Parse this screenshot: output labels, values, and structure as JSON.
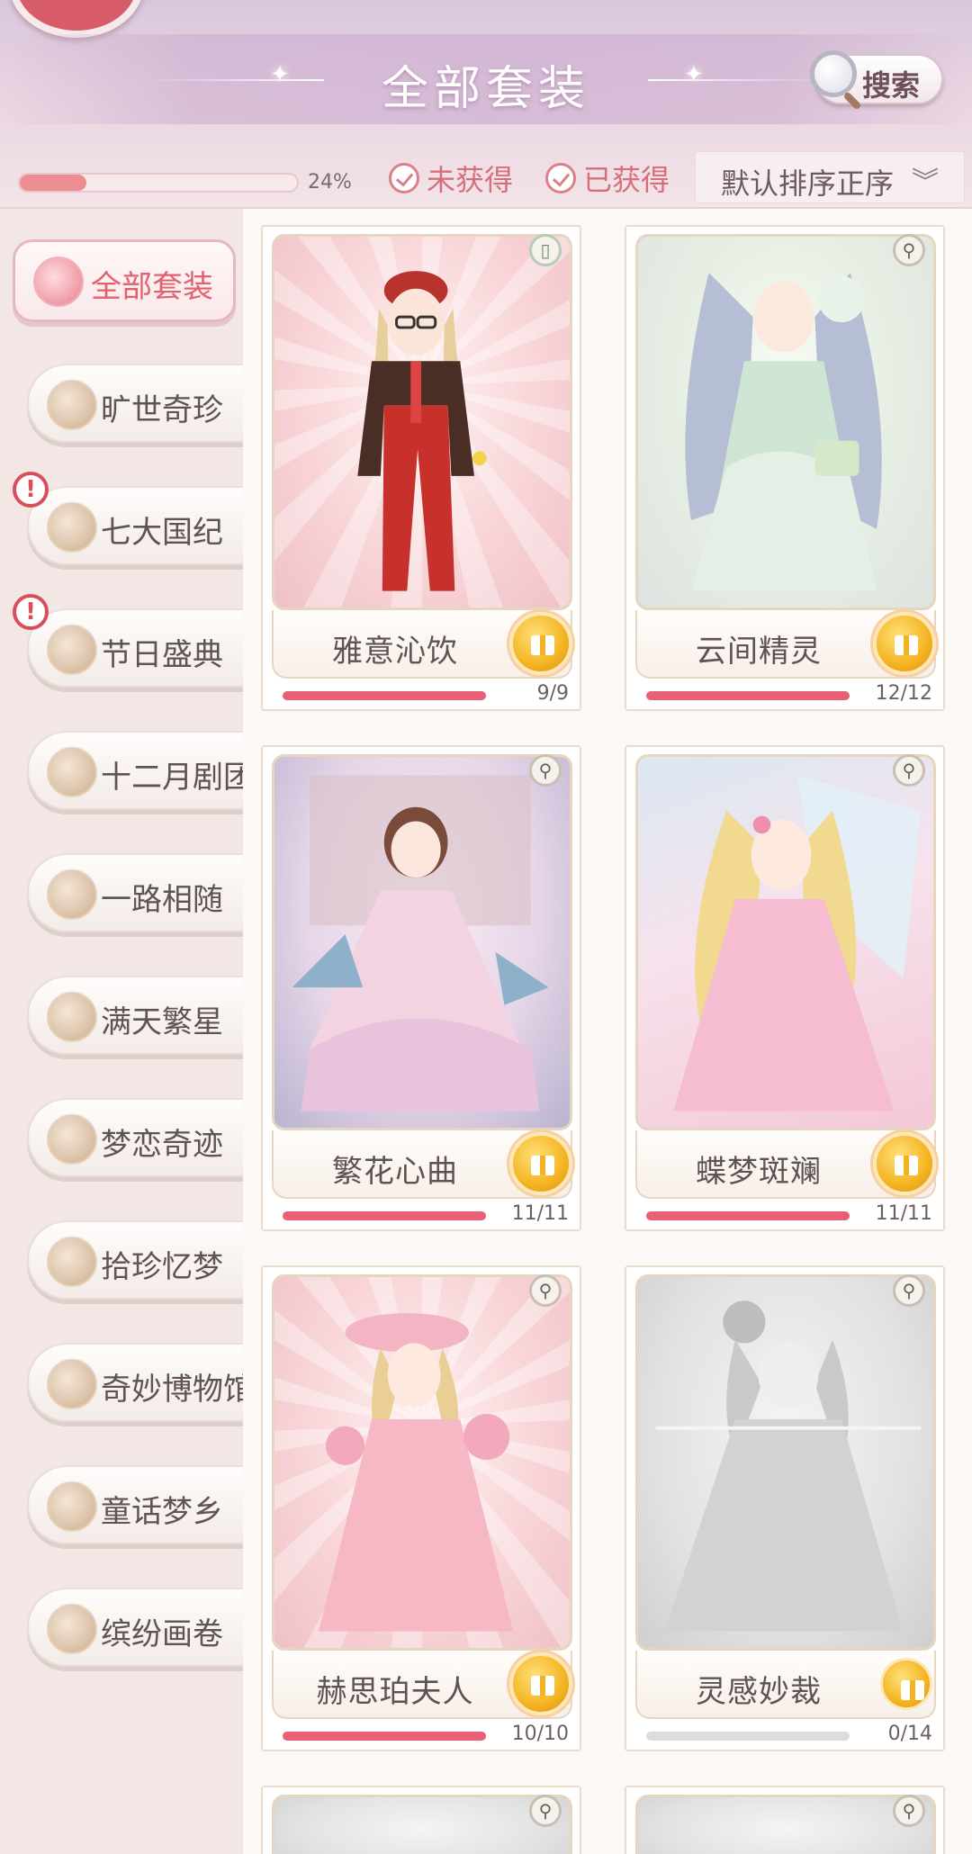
{
  "header": {
    "title": "全部套装",
    "search_label": "搜索",
    "progress_text": "24%",
    "progress_fraction": 0.24,
    "filters": [
      {
        "label": "未获得"
      },
      {
        "label": "已获得"
      }
    ],
    "sort_label": "默认排序正序",
    "sort_chevron": "︾"
  },
  "sidebar": {
    "items": [
      {
        "label": "全部套装",
        "active": true
      },
      {
        "label": "旷世奇珍"
      },
      {
        "label": "七大国纪",
        "alert": true
      },
      {
        "label": "节日盛典",
        "alert": true
      },
      {
        "label": "十二月剧团"
      },
      {
        "label": "一路相随"
      },
      {
        "label": "满天繁星"
      },
      {
        "label": "梦恋奇迹"
      },
      {
        "label": "拾珍忆梦"
      },
      {
        "label": "奇妙博物馆"
      },
      {
        "label": "童话梦乡"
      },
      {
        "label": "缤纷画卷"
      }
    ],
    "alert_glyph": "!"
  },
  "cards": [
    {
      "name": "雅意沁饮",
      "count": "9/9",
      "progress": 1.0,
      "badge_icon": "battery-icon",
      "badge_glyph": "▯"
    },
    {
      "name": "云间精灵",
      "count": "12/12",
      "progress": 1.0,
      "badge_icon": "person-icon",
      "badge_glyph": "⚲"
    },
    {
      "name": "繁花心曲",
      "count": "11/11",
      "progress": 1.0,
      "badge_icon": "person-icon",
      "badge_glyph": "⚲"
    },
    {
      "name": "蝶梦斑斓",
      "count": "11/11",
      "progress": 1.0,
      "badge_icon": "person-icon",
      "badge_glyph": "⚲"
    },
    {
      "name": "赫思珀夫人",
      "count": "10/10",
      "progress": 1.0,
      "badge_icon": "person-icon",
      "badge_glyph": "⚲"
    },
    {
      "name": "灵感妙裁",
      "count": "0/14",
      "progress": 0.0,
      "badge_icon": "person-icon",
      "badge_glyph": "⚲"
    }
  ],
  "colors": {
    "accent": "#e06170",
    "progress": "#e95f74",
    "header_bg": "#d8c6dc"
  }
}
